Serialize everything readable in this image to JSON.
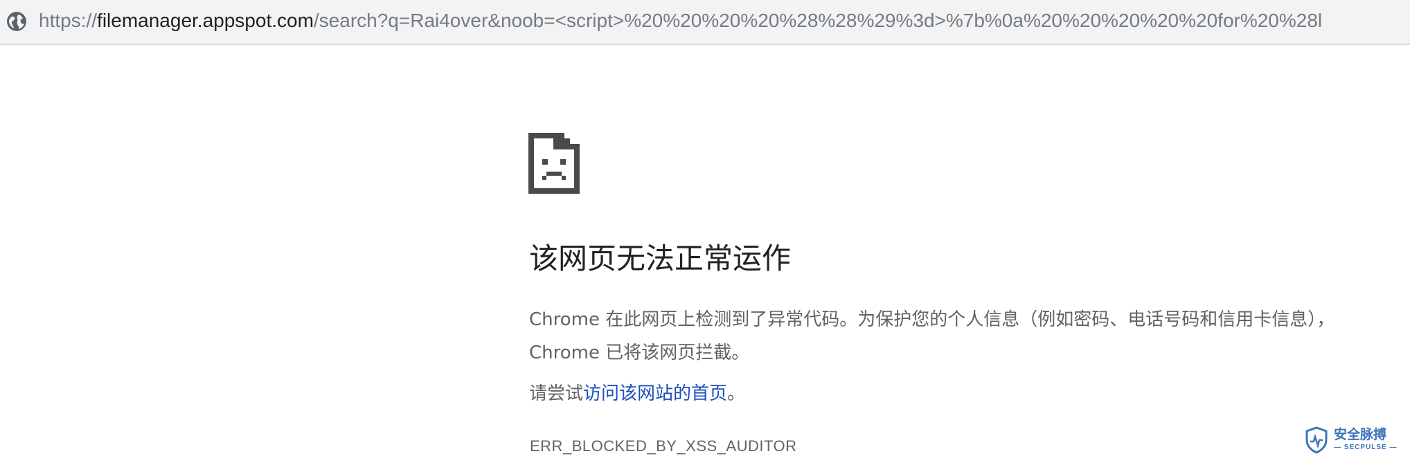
{
  "address_bar": {
    "icon": "globe-icon",
    "url_scheme": "https://",
    "url_host": "filemanager.appspot.com",
    "url_path": "/search?q=Rai4over&noob=<script>%20%20%20%20%28%28%29%3d>%7b%0a%20%20%20%20%20for%20%28l"
  },
  "error_page": {
    "icon": "sad-page-icon",
    "title": "该网页无法正常运作",
    "description_line1": "Chrome 在此网页上检测到了异常代码。为保护您的个人信息（例如密码、电话号码和信用卡信息），",
    "description_line2": "Chrome 已将该网页拦截。",
    "try_prefix": "请尝试",
    "try_link": "访问该网站的首页",
    "try_suffix": "。",
    "error_code": "ERR_BLOCKED_BY_XSS_AUDITOR"
  },
  "watermark": {
    "icon": "shield-logo-icon",
    "text_cn": "安全脉搏",
    "text_en": "— SECPULSE —"
  },
  "colors": {
    "address_bar_bg": "#f1f3f4",
    "title_text": "#202124",
    "body_text": "#5f6368",
    "link": "#1a4fbd",
    "icon_dark": "#4a4a4a",
    "watermark": "#3d74b8"
  }
}
